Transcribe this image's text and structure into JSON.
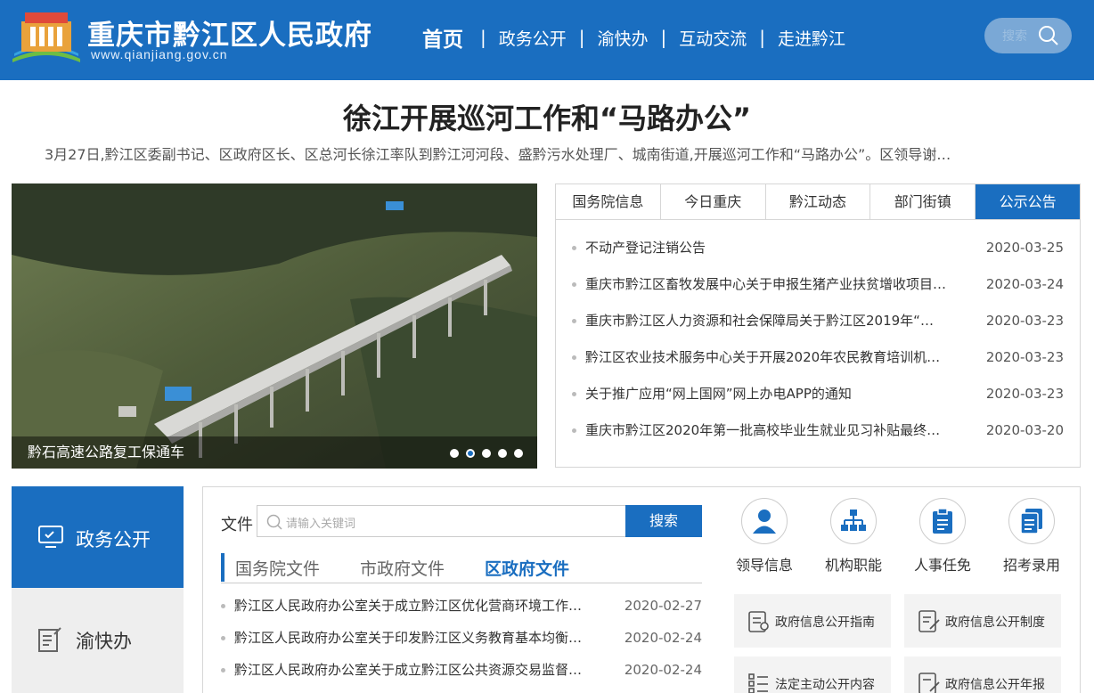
{
  "header": {
    "site_title": "重庆市黔江区人民政府",
    "site_url": "www.qianjiang.gov.cn",
    "nav": [
      "首页",
      "政务公开",
      "渝快办",
      "互动交流",
      "走进黔江"
    ],
    "search_placeholder": "搜索"
  },
  "headline": {
    "title": "徐江开展巡河工作和“马路办公”",
    "summary": "3月27日,黔江区委副书记、区政府区长、区总河长徐江率队到黔江河河段、盛黔污水处理厂、城南街道,开展巡河工作和“马路办公”。区领导谢…"
  },
  "slideshow": {
    "caption": "黔石高速公路复工保通车",
    "dots": 5,
    "active_dot": 2
  },
  "news": {
    "tabs": [
      "国务院信息",
      "今日重庆",
      "黔江动态",
      "部门街镇",
      "公示公告"
    ],
    "active_tab": 4,
    "items": [
      {
        "title": "不动产登记注销公告",
        "date": "2020-03-25"
      },
      {
        "title": "重庆市黔江区畜牧发展中心关于申报生猪产业扶贫增收项目…",
        "date": "2020-03-24"
      },
      {
        "title": "重庆市黔江区人力资源和社会保障局关于黔江区2019年“…",
        "date": "2020-03-23"
      },
      {
        "title": "黔江区农业技术服务中心关于开展2020年农民教育培训机…",
        "date": "2020-03-23"
      },
      {
        "title": "关于推广应用“网上国网”网上办电APP的通知",
        "date": "2020-03-23"
      },
      {
        "title": "重庆市黔江区2020年第一批高校毕业生就业见习补贴最终…",
        "date": "2020-03-20"
      }
    ]
  },
  "side_menu": {
    "items": [
      "政务公开",
      "渝快办"
    ]
  },
  "documents": {
    "label": "文件",
    "placeholder": "请输入关键词",
    "search_button": "搜索",
    "tabs": [
      "国务院文件",
      "市政府文件",
      "区政府文件"
    ],
    "active_tab": 2,
    "items": [
      {
        "title": "黔江区人民政府办公室关于成立黔江区优化营商环境工作…",
        "date": "2020-02-27"
      },
      {
        "title": "黔江区人民政府办公室关于印发黔江区义务教育基本均衡…",
        "date": "2020-02-24"
      },
      {
        "title": "黔江区人民政府办公室关于成立黔江区公共资源交易监督…",
        "date": "2020-02-24"
      }
    ]
  },
  "quick_links": [
    {
      "label": "领导信息",
      "icon": "leader-icon"
    },
    {
      "label": "机构职能",
      "icon": "org-chart-icon"
    },
    {
      "label": "人事任免",
      "icon": "personnel-icon"
    },
    {
      "label": "招考录用",
      "icon": "recruit-icon"
    }
  ],
  "info_buttons": [
    "政府信息公开指南",
    "政府信息公开制度",
    "法定主动公开内容",
    "政府信息公开年报"
  ],
  "colors": {
    "brand_blue": "#1a6ec0",
    "light_gray": "#eeeeee"
  }
}
